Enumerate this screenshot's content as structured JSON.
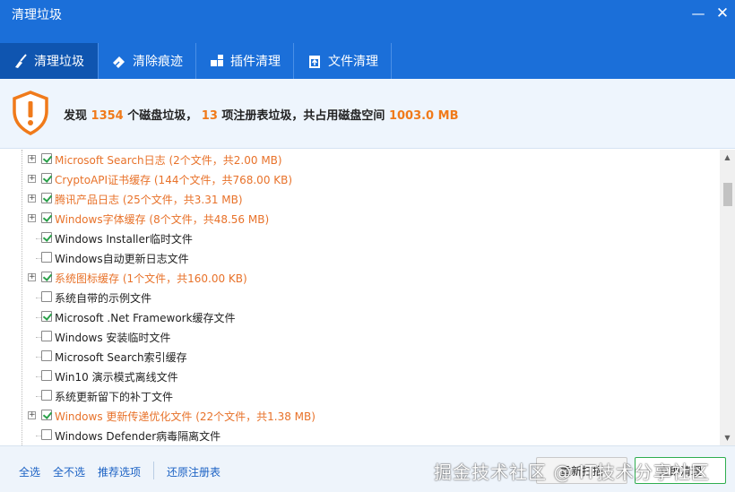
{
  "window": {
    "title": "清理垃圾",
    "minimize_glyph": "—",
    "close_glyph": "✕"
  },
  "tabs": [
    {
      "label": "清理垃圾",
      "icon": "broom-icon",
      "active": true
    },
    {
      "label": "清除痕迹",
      "icon": "eraser-icon",
      "active": false
    },
    {
      "label": "插件清理",
      "icon": "puzzle-icon",
      "active": false
    },
    {
      "label": "文件清理",
      "icon": "trash-icon",
      "active": false
    }
  ],
  "summary": {
    "icon": "warning-shield-icon",
    "prefix": "发现 ",
    "disk_count": "1354",
    "mid1": " 个磁盘垃圾， ",
    "registry_count": "13",
    "mid2": " 项注册表垃圾，共占用磁盘空间 ",
    "space": "1003.0 MB",
    "accent_color": "#f07a1a"
  },
  "items": [
    {
      "label": "Microsoft Search日志 (2个文件，共2.00 MB)",
      "checked": true,
      "expandable": true,
      "highlight": true
    },
    {
      "label": "CryptoAPI证书缓存 (144个文件，共768.00 KB)",
      "checked": true,
      "expandable": true,
      "highlight": true
    },
    {
      "label": "腾讯产品日志 (25个文件，共3.31 MB)",
      "checked": true,
      "expandable": true,
      "highlight": true
    },
    {
      "label": "Windows字体缓存 (8个文件，共48.56 MB)",
      "checked": true,
      "expandable": true,
      "highlight": true
    },
    {
      "label": "Windows Installer临时文件",
      "checked": true,
      "expandable": false,
      "highlight": false
    },
    {
      "label": "Windows自动更新日志文件",
      "checked": false,
      "expandable": false,
      "highlight": false
    },
    {
      "label": "系统图标缓存 (1个文件，共160.00 KB)",
      "checked": true,
      "expandable": true,
      "highlight": true
    },
    {
      "label": "系统自带的示例文件",
      "checked": false,
      "expandable": false,
      "highlight": false
    },
    {
      "label": "Microsoft .Net Framework缓存文件",
      "checked": true,
      "expandable": false,
      "highlight": false
    },
    {
      "label": "Windows 安装临时文件",
      "checked": false,
      "expandable": false,
      "highlight": false
    },
    {
      "label": "Microsoft Search索引缓存",
      "checked": false,
      "expandable": false,
      "highlight": false
    },
    {
      "label": "Win10 演示模式离线文件",
      "checked": false,
      "expandable": false,
      "highlight": false
    },
    {
      "label": "系统更新留下的补丁文件",
      "checked": false,
      "expandable": false,
      "highlight": false
    },
    {
      "label": "Windows 更新传递优化文件 (22个文件，共1.38 MB)",
      "checked": true,
      "expandable": true,
      "highlight": true
    },
    {
      "label": "Windows Defender病毒隔离文件",
      "checked": false,
      "expandable": false,
      "highlight": false
    }
  ],
  "scrollbar": {
    "up_glyph": "▲",
    "down_glyph": "▼"
  },
  "bottom": {
    "select_all": "全选",
    "select_none": "全不选",
    "recommended": "推荐选项",
    "restore_registry": "还原注册表",
    "rescan": "重新扫描",
    "clean": "立即清理",
    "watermark": "掘金技术社区 @ IT技术分享社区"
  }
}
